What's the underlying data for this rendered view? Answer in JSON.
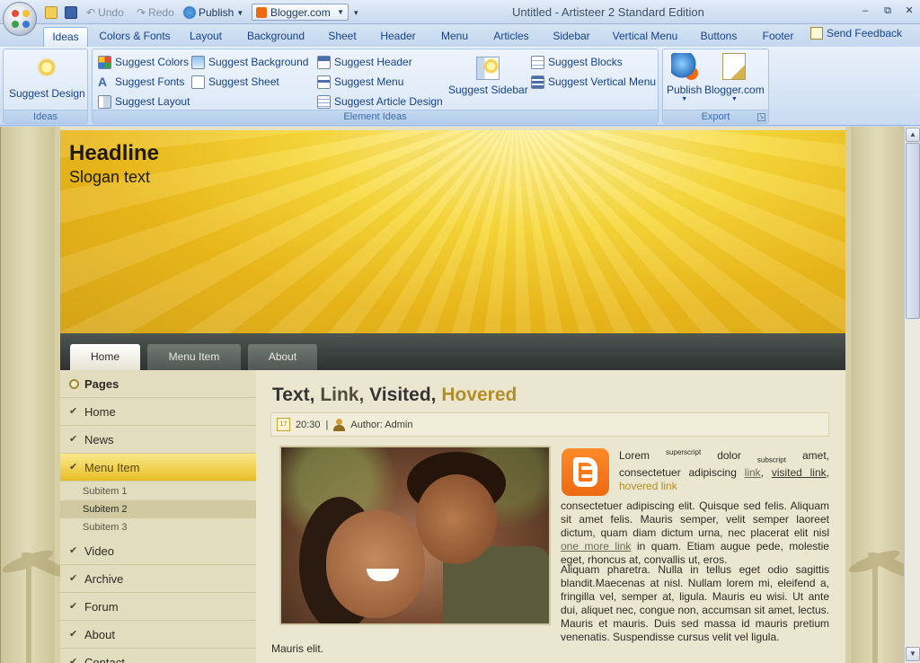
{
  "app": {
    "title": "Untitled - Artisteer 2 Standard Edition",
    "quick_access": {
      "undo_label": "Undo",
      "redo_label": "Redo",
      "publish_label": "Publish",
      "target_combo": "Blogger.com"
    },
    "window_controls": {
      "minimize": "‒",
      "restore": "⧉",
      "close": "✕"
    }
  },
  "ribbon": {
    "tabs": [
      {
        "label": "Ideas",
        "active": true
      },
      {
        "label": "Colors & Fonts"
      },
      {
        "label": "Layout"
      },
      {
        "label": "Background"
      },
      {
        "label": "Sheet"
      },
      {
        "label": "Header"
      },
      {
        "label": "Menu"
      },
      {
        "label": "Articles"
      },
      {
        "label": "Sidebar"
      },
      {
        "label": "Vertical Menu"
      },
      {
        "label": "Buttons"
      },
      {
        "label": "Footer"
      }
    ],
    "feedback_label": "Send Feedback",
    "groups": {
      "ideas": {
        "label": "Ideas",
        "suggest_design": "Suggest Design"
      },
      "element_ideas": {
        "label": "Element Ideas",
        "buttons": [
          "Suggest Colors",
          "Suggest Fonts",
          "Suggest Layout",
          "Suggest Background",
          "Suggest Sheet",
          "Suggest Header",
          "Suggest Menu",
          "Suggest Article Design",
          "Suggest Sidebar",
          "Suggest Blocks",
          "Suggest Vertical Menu"
        ]
      },
      "export": {
        "label": "Export",
        "publish": "Publish",
        "blogger": "Blogger.com"
      }
    }
  },
  "preview": {
    "header": {
      "headline": "Headline",
      "slogan": "Slogan text"
    },
    "menu": [
      "Home",
      "Menu Item",
      "About"
    ],
    "sidebar": {
      "heading": "Pages",
      "items": [
        "Home",
        "News",
        "Menu Item",
        "Video",
        "Archive",
        "Forum",
        "About",
        "Contact"
      ],
      "subitems": [
        "Subitem 1",
        "Subitem 2",
        "Subitem 3"
      ]
    },
    "post": {
      "title_text": "Text,",
      "title_link": "Link,",
      "title_visited": "Visited,",
      "title_hovered": "Hovered",
      "time": "20:30",
      "sep": "|",
      "author": "Author: Admin",
      "cal_day": "17",
      "p1": {
        "lorem": "Lorem",
        "superscript": "superscript",
        "dolor": "dolor",
        "subscript": "subscript",
        "amet": "amet, consectetuer adipiscing",
        "link": "link",
        "comma": ",",
        "visited": "visited link",
        "comma2": ",",
        "hovered": "hovered link",
        "rest1": "consectetuer adipiscing elit. Quisque sed felis. Aliquam sit amet felis. Mauris semper, velit semper laoreet dictum, quam diam dictum urna, nec placerat elit nisl",
        "one_more": "one more link",
        "rest2": "in quam. Etiam augue pede, molestie eget, rhoncus at, convallis ut, eros."
      },
      "p2": "Aliquam pharetra. Nulla in tellus eget odio sagittis blandit.Maecenas at nisl. Nullam lorem mi, eleifend a, fringilla vel, semper at, ligula. Mauris eu wisi. Ut ante dui, aliquet nec, congue non, accumsan sit amet, lectus. Mauris et mauris. Duis sed massa id mauris pretium venenatis. Suspendisse cursus velit vel ligula.",
      "p3": "Mauris elit."
    }
  },
  "colors": {
    "ribbon_text": "#15428b",
    "header_gold": "#eab81b",
    "hovered_link": "#b08f2a",
    "menu_dark": "#2e3332"
  },
  "icons": [
    "office-orb-icon",
    "open-icon",
    "save-icon",
    "undo-icon",
    "redo-icon",
    "publish-icon",
    "blogger-icon",
    "lightbulb-icon",
    "feedback-icon",
    "calendar-icon",
    "author-icon"
  ]
}
